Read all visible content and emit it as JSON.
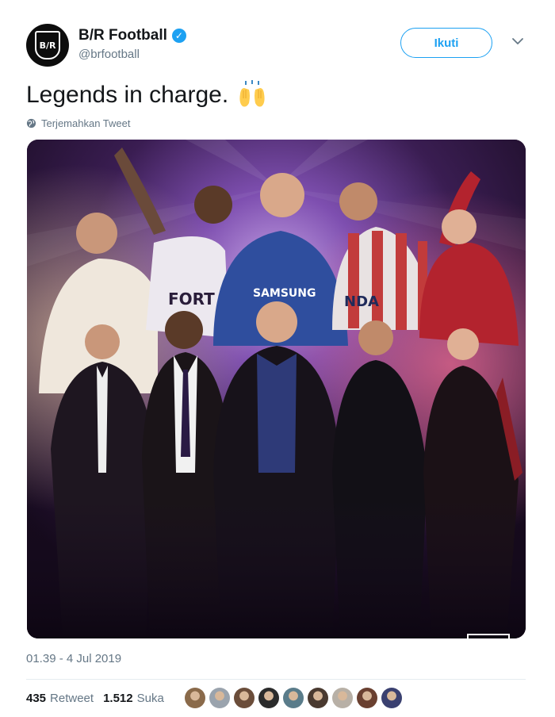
{
  "author": {
    "display_name": "B/R Football",
    "handle": "@brfootball",
    "avatar_text": "B/R",
    "verified": true
  },
  "follow_button": {
    "label": "Ikuti"
  },
  "tweet": {
    "text": "Legends in charge.",
    "emoji": "raising-hands",
    "translate_label": "Terjemahkan Tweet"
  },
  "media": {
    "jersey_texts": [
      "FORT",
      "SAMSUNG",
      "NDA"
    ]
  },
  "timestamp": "01.39 - 4 Jul 2019",
  "stats": {
    "retweets_count": "435",
    "retweets_label": "Retweet",
    "likes_count": "1.512",
    "likes_label": "Suka"
  },
  "likers": [
    {
      "color": "#8a6a4a"
    },
    {
      "color": "#9aa3ad"
    },
    {
      "color": "#6b4d3a"
    },
    {
      "color": "#2b2b2b"
    },
    {
      "color": "#5a7c8a"
    },
    {
      "color": "#4a3a30"
    },
    {
      "color": "#b8b0a6"
    },
    {
      "color": "#6a4030"
    },
    {
      "color": "#3a4070"
    }
  ],
  "colors": {
    "accent": "#1da1f2",
    "text_primary": "#14171a",
    "text_secondary": "#657786"
  }
}
